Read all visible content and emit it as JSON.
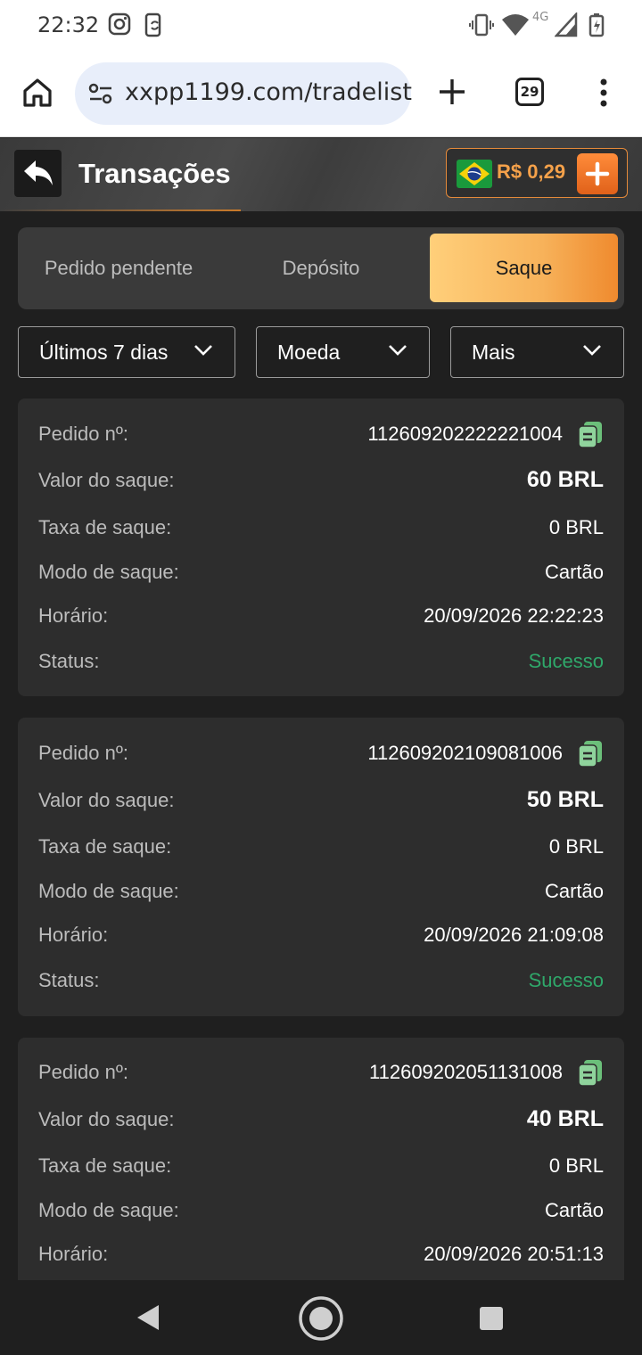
{
  "status_bar": {
    "time": "22:32",
    "network": "4G",
    "icons": [
      "instagram-icon",
      "sync-icon",
      "vibrate-icon",
      "wifi-icon",
      "signal-icon",
      "battery-icon"
    ]
  },
  "browser": {
    "url": "xxpp1199.com/tradelist",
    "tab_count": "29",
    "icons": [
      "home-icon",
      "site-settings-icon",
      "new-tab-icon",
      "tab-switcher-icon",
      "menu-icon"
    ]
  },
  "header": {
    "title": "Transações",
    "balance": "R$ 0,29",
    "flag": "brazil-flag-icon"
  },
  "tabs": [
    {
      "label": "Pedido pendente",
      "active": false
    },
    {
      "label": "Depósito",
      "active": false
    },
    {
      "label": "Saque",
      "active": true
    }
  ],
  "filters": [
    {
      "label": "Últimos 7 dias"
    },
    {
      "label": "Moeda"
    },
    {
      "label": "Mais"
    }
  ],
  "labels": {
    "order": "Pedido nº:",
    "amount": "Valor do saque:",
    "fee": "Taxa de saque:",
    "mode": "Modo de saque:",
    "time": "Horário:",
    "status": "Status:"
  },
  "transactions": [
    {
      "order": "112609202222221004",
      "amount": "60 BRL",
      "fee": "0 BRL",
      "mode": "Cartão",
      "time": "20/09/2026 22:22:23",
      "status": "Sucesso"
    },
    {
      "order": "112609202109081006",
      "amount": "50 BRL",
      "fee": "0 BRL",
      "mode": "Cartão",
      "time": "20/09/2026 21:09:08",
      "status": "Sucesso"
    },
    {
      "order": "112609202051131008",
      "amount": "40 BRL",
      "fee": "0 BRL",
      "mode": "Cartão",
      "time": "20/09/2026 20:51:13",
      "status": ""
    }
  ],
  "colors": {
    "accent": "#f5a14a",
    "success": "#2fa86a",
    "card": "#2d2d2d",
    "background": "#1f1f1f"
  }
}
